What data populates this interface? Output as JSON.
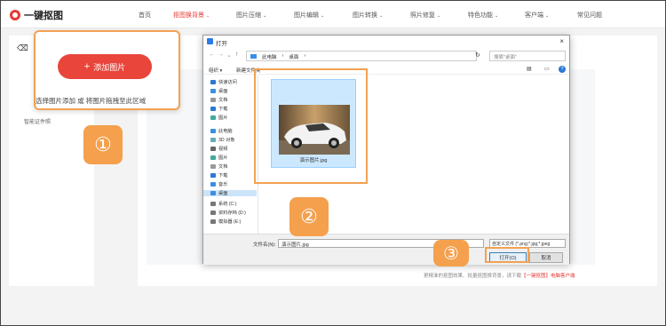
{
  "app": {
    "logo_text": "一键抠图"
  },
  "nav": {
    "items": [
      {
        "label": "首页",
        "dropdown": false,
        "active": false
      },
      {
        "label": "抠图换背景",
        "dropdown": true,
        "active": true
      },
      {
        "label": "图片压缩",
        "dropdown": true,
        "active": false
      },
      {
        "label": "图片编辑",
        "dropdown": true,
        "active": false
      },
      {
        "label": "图片转换",
        "dropdown": true,
        "active": false
      },
      {
        "label": "照片修复",
        "dropdown": true,
        "active": false
      },
      {
        "label": "特色功能",
        "dropdown": true,
        "active": false
      },
      {
        "label": "客户端",
        "dropdown": true,
        "active": false
      },
      {
        "label": "常见问题",
        "dropdown": false,
        "active": false
      }
    ],
    "chevron": "⌄"
  },
  "sidebar": {
    "rows": [
      "智能证件照"
    ]
  },
  "upload": {
    "button_icon": "+",
    "button_label": "添加图片",
    "hint": "选择图片添加 或 将图片拖拽至此区域"
  },
  "steps": [
    "①",
    "②",
    "③"
  ],
  "footnote": {
    "prefix": "更精准的抠图效果、批量抠图换背景，请下载",
    "link": "【一键抠图】电脑客户端"
  },
  "dialog": {
    "title": "打开",
    "close": "×",
    "path": [
      "此电脑",
      "›",
      "桌面",
      "›"
    ],
    "search_placeholder": "搜索\"桌面\"",
    "toolbar": {
      "organize": "组织 ▾",
      "new_folder": "新建文件夹",
      "help": "?"
    },
    "tree": [
      {
        "label": "快速访问",
        "icon": "star-icon",
        "color": "#2b78d6"
      },
      {
        "label": "桌面",
        "icon": "desktop-icon",
        "color": "#3a8ee6"
      },
      {
        "label": "文档",
        "icon": "document-icon",
        "color": "#999"
      },
      {
        "label": "下载",
        "icon": "download-icon",
        "color": "#2b78d6"
      },
      {
        "label": "图片",
        "icon": "picture-icon",
        "color": "#4a9"
      },
      {
        "label": "此电脑",
        "icon": "computer-icon",
        "color": "#3a8ee6"
      },
      {
        "label": "3D 对象",
        "icon": "cube-icon",
        "color": "#6ab"
      },
      {
        "label": "视频",
        "icon": "video-icon",
        "color": "#666"
      },
      {
        "label": "图片",
        "icon": "picture-icon",
        "color": "#4a9"
      },
      {
        "label": "文档",
        "icon": "document-icon",
        "color": "#999"
      },
      {
        "label": "下载",
        "icon": "download-icon",
        "color": "#2b78d6"
      },
      {
        "label": "音乐",
        "icon": "music-icon",
        "color": "#3a8ee6"
      },
      {
        "label": "桌面",
        "icon": "desktop-icon",
        "color": "#3a8ee6"
      },
      {
        "label": "系统 (C:)",
        "icon": "drive-icon",
        "color": "#777"
      },
      {
        "label": "资料存档 (D:)",
        "icon": "drive-icon",
        "color": "#777"
      },
      {
        "label": "模拟器 (E:)",
        "icon": "drive-icon",
        "color": "#777"
      }
    ],
    "file": {
      "name": "演示图片.jpg"
    },
    "filename_label": "文件名(N):",
    "filename_value": "演示图片.jpg",
    "filetype": "自定义文件 (*.png;*.jpg;*.jpeg",
    "open_label": "打开(O)",
    "cancel_label": "取消"
  }
}
